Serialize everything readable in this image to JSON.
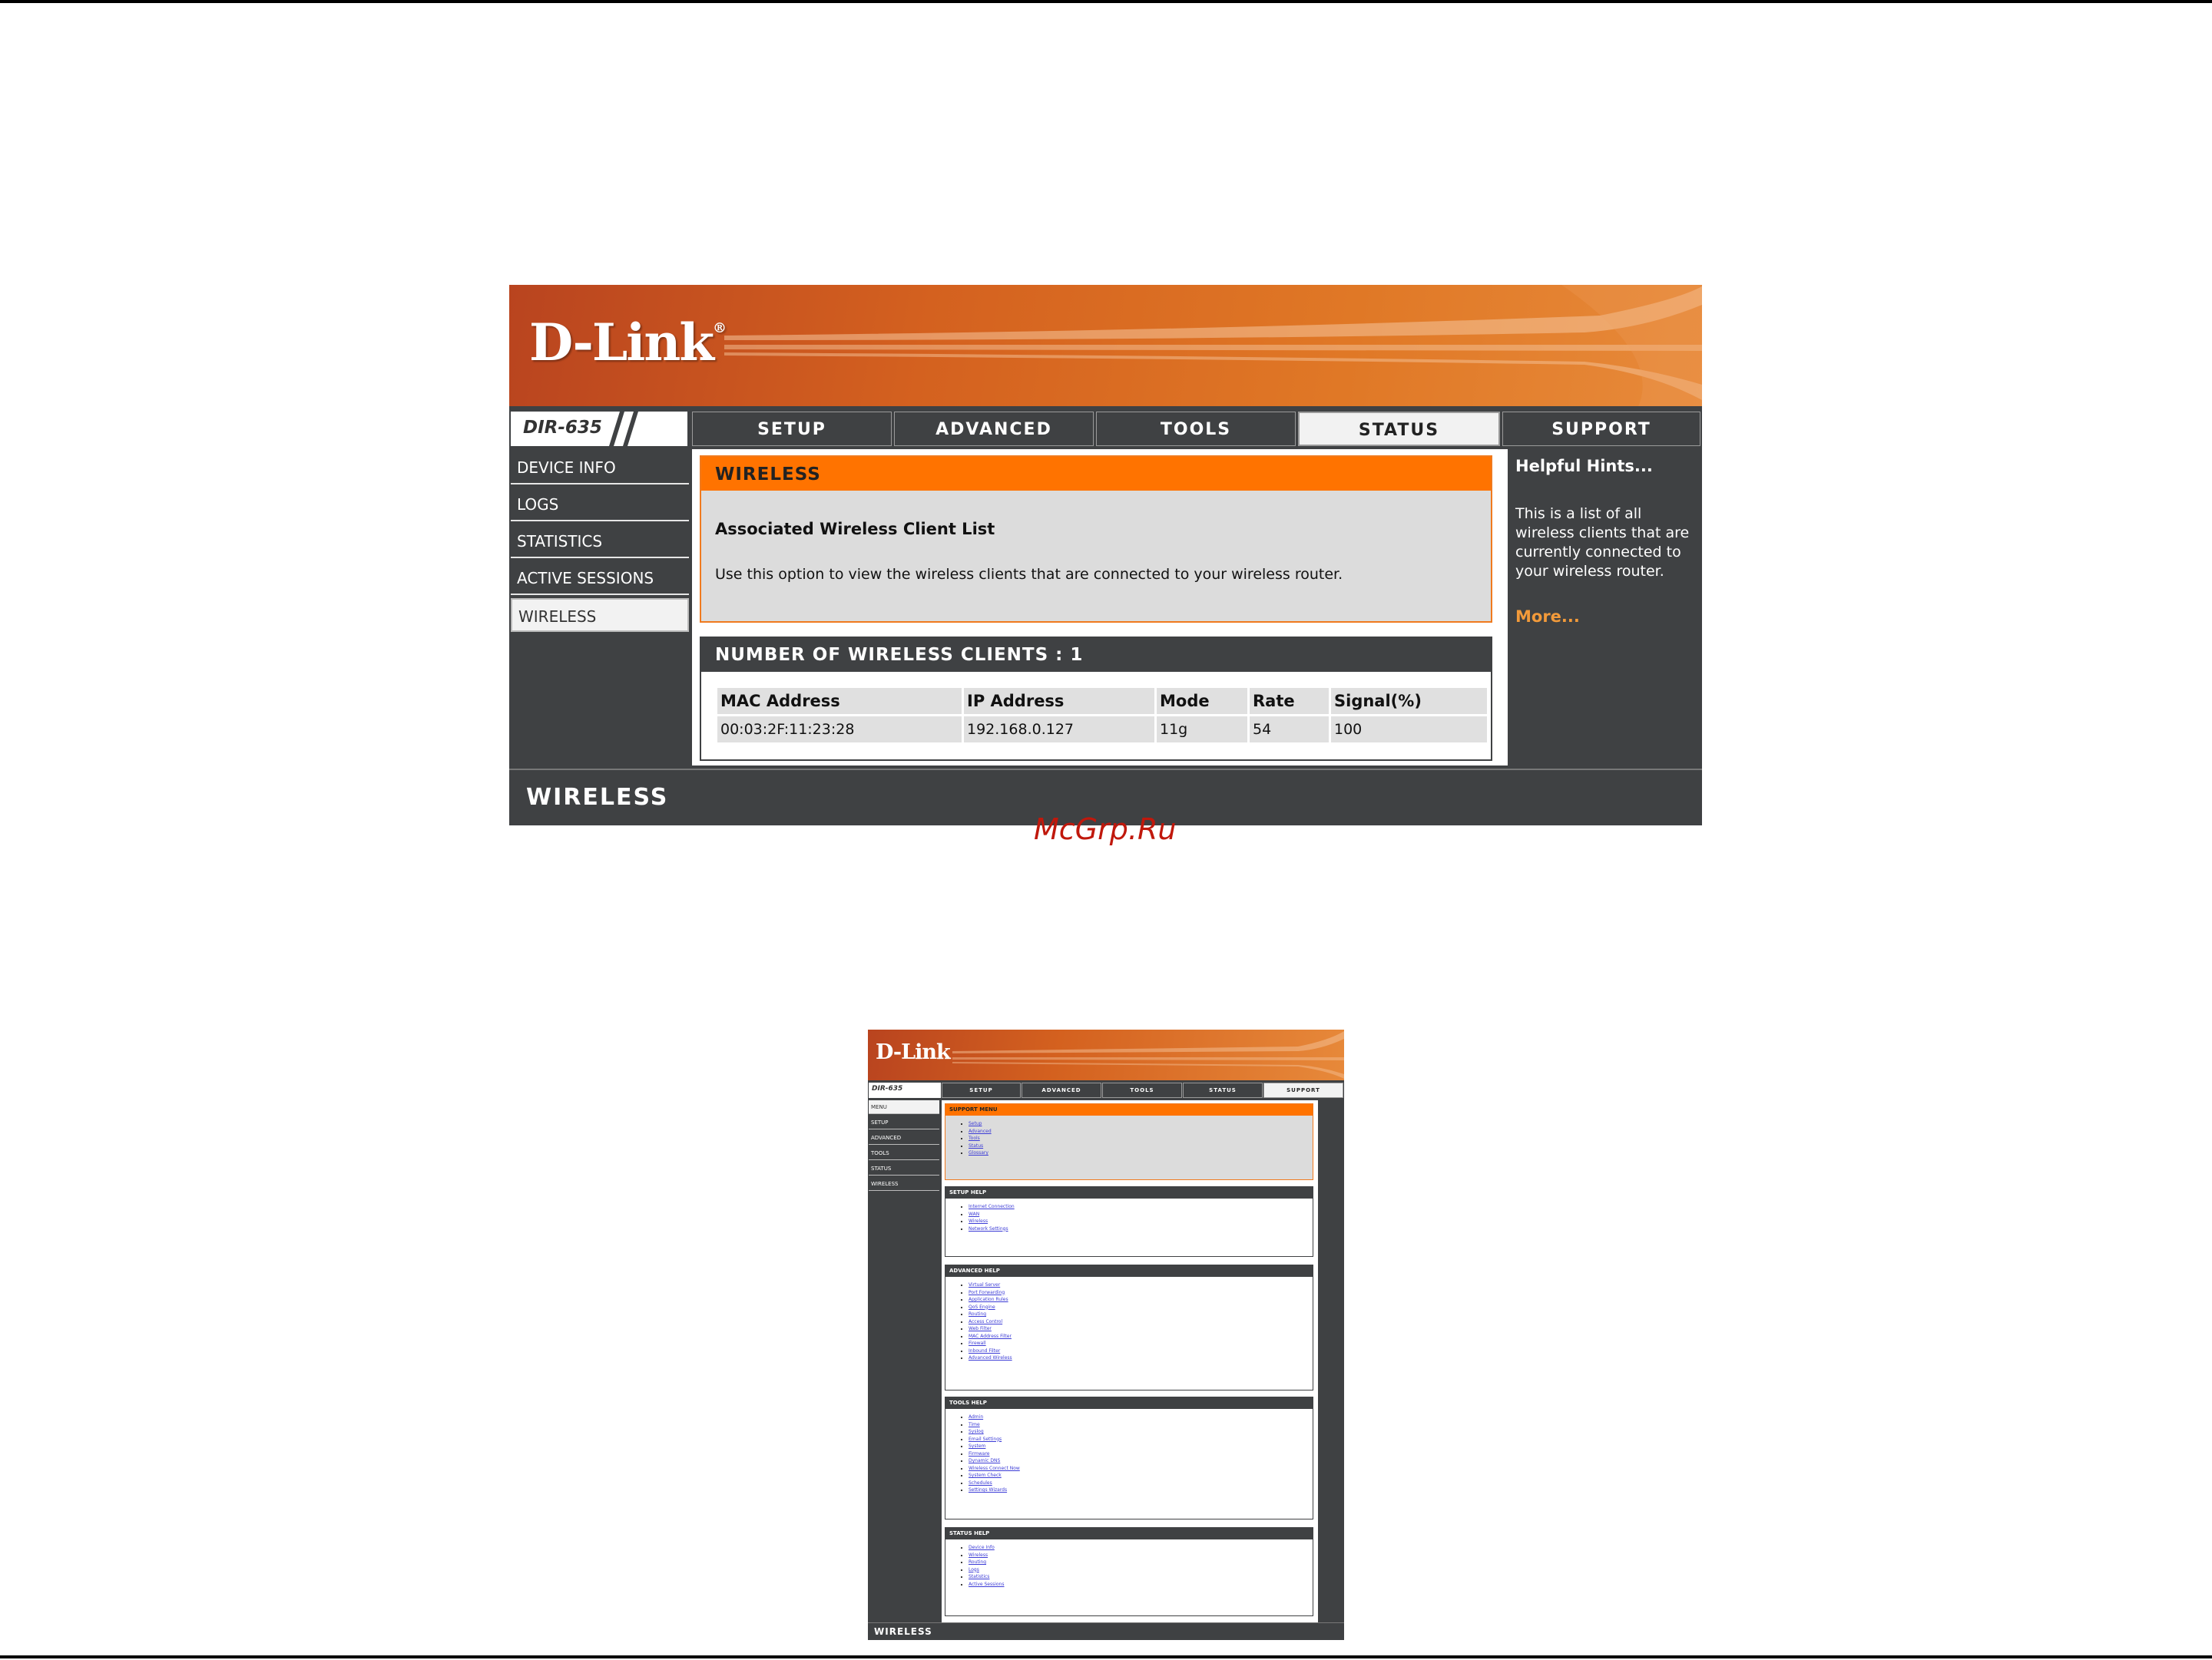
{
  "brand": {
    "logo_text": "D-Link",
    "registered_mark": "®",
    "model": "DIR-635",
    "colors": {
      "orange": "#ff7300",
      "dark": "#3f4143",
      "light": "#dcdcdc",
      "link": "#f29a3a"
    }
  },
  "screen1": {
    "tabs": [
      {
        "label": "SETUP"
      },
      {
        "label": "ADVANCED"
      },
      {
        "label": "TOOLS"
      },
      {
        "label": "STATUS",
        "active": true
      },
      {
        "label": "SUPPORT"
      }
    ],
    "sidebar": [
      {
        "label": "DEVICE INFO"
      },
      {
        "label": "LOGS"
      },
      {
        "label": "STATISTICS"
      },
      {
        "label": "ACTIVE SESSIONS"
      },
      {
        "label": "WIRELESS",
        "active": true
      }
    ],
    "wireless_panel": {
      "title": "WIRELESS",
      "subtitle": "Associated Wireless Client List",
      "description": "Use this option to view the wireless clients that are connected to your wireless router."
    },
    "clients_panel": {
      "title": "NUMBER OF WIRELESS CLIENTS : 1",
      "columns": [
        "MAC Address",
        "IP Address",
        "Mode",
        "Rate",
        "Signal(%)"
      ],
      "rows": [
        [
          "00:03:2F:11:23:28",
          "192.168.0.127",
          "11g",
          "54",
          "100"
        ]
      ]
    },
    "hints": {
      "title": "Helpful Hints...",
      "text": "This is a list of all wireless clients that are currently connected to your wireless router.",
      "more": "More..."
    },
    "footer": "WIRELESS"
  },
  "watermark": "McGrp.Ru",
  "screen2": {
    "tabs": [
      {
        "label": "SETUP"
      },
      {
        "label": "ADVANCED"
      },
      {
        "label": "TOOLS"
      },
      {
        "label": "STATUS"
      },
      {
        "label": "SUPPORT",
        "active": true
      }
    ],
    "sidebar": [
      "MENU",
      "SETUP",
      "ADVANCED",
      "TOOLS",
      "STATUS",
      "WIRELESS"
    ],
    "sections": [
      {
        "title": "SUPPORT MENU",
        "links": [
          "Setup",
          "Advanced",
          "Tools",
          "Status",
          "Glossary"
        ]
      },
      {
        "title": "SETUP HELP",
        "links": [
          "Internet Connection",
          "WAN",
          "Wireless",
          "Network Settings"
        ]
      },
      {
        "title": "ADVANCED HELP",
        "links": [
          "Virtual Server",
          "Port Forwarding",
          "Application Rules",
          "QoS Engine",
          "Routing",
          "Access Control",
          "Web Filter",
          "MAC Address Filter",
          "Firewall",
          "Inbound Filter",
          "Advanced Wireless"
        ]
      },
      {
        "title": "TOOLS HELP",
        "links": [
          "Admin",
          "Time",
          "Syslog",
          "Email Settings",
          "System",
          "Firmware",
          "Dynamic DNS",
          "Wireless Connect Now",
          "System Check",
          "Schedules",
          "Settings Wizards"
        ]
      },
      {
        "title": "STATUS HELP",
        "links": [
          "Device Info",
          "Wireless",
          "Routing",
          "Logs",
          "Statistics",
          "Active Sessions"
        ]
      }
    ],
    "footer": "WIRELESS"
  }
}
